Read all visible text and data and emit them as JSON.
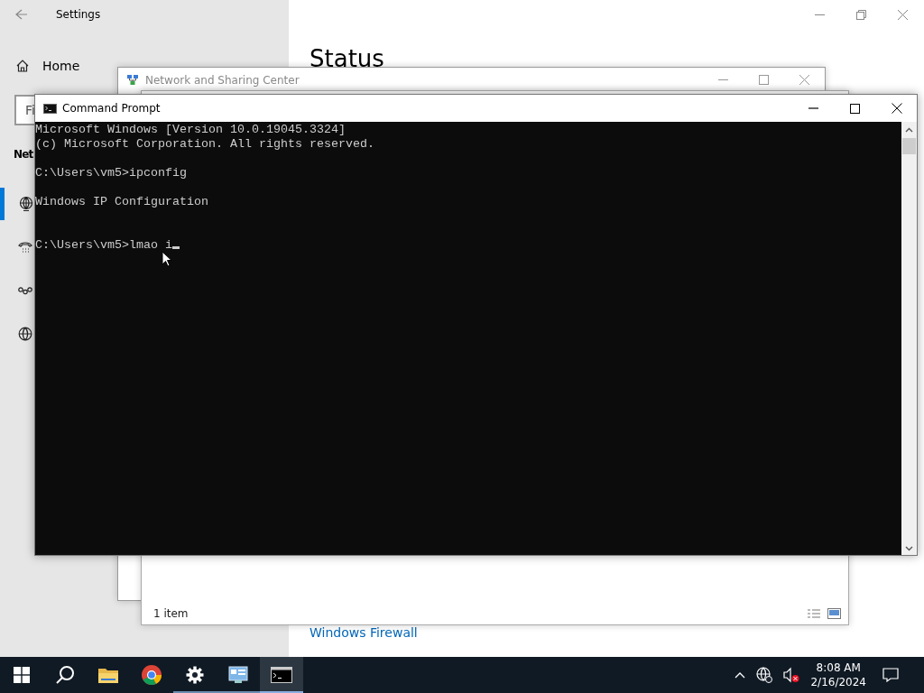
{
  "settings": {
    "title": "Settings",
    "home": "Home",
    "search": {
      "placeholder": "Fi"
    },
    "section_heading": "Net",
    "nav_items": [
      {
        "kind": "ethernet",
        "selected": true
      },
      {
        "kind": "dialup",
        "selected": false
      },
      {
        "kind": "vpn",
        "selected": false
      },
      {
        "kind": "proxy",
        "selected": false
      }
    ],
    "page_title": "Status",
    "link": "Windows Firewall"
  },
  "network_window": {
    "title": "Network and Sharing Center"
  },
  "explorer_window": {
    "status": "1 item"
  },
  "cmd": {
    "title": "Command Prompt",
    "cursor_visible": true,
    "lines": [
      {
        "kind": "text",
        "text": "Microsoft Windows [Version 10.0.19045.3324]"
      },
      {
        "kind": "text",
        "text": "(c) Microsoft Corporation. All rights reserved."
      },
      {
        "kind": "blank"
      },
      {
        "kind": "text",
        "text": "C:\\Users\\vm5>ipconfig"
      },
      {
        "kind": "blank"
      },
      {
        "kind": "text",
        "text": "Windows IP Configuration"
      },
      {
        "kind": "blank"
      },
      {
        "kind": "blank"
      },
      {
        "kind": "text",
        "text": "C:\\Users\\vm5>lmao i"
      }
    ]
  },
  "taskbar": {
    "items": [
      {
        "kind": "search",
        "running": false,
        "selected": false
      },
      {
        "kind": "folder",
        "running": false,
        "selected": false
      },
      {
        "kind": "browser",
        "running": false,
        "selected": false
      },
      {
        "kind": "gear",
        "running": true,
        "selected": false
      },
      {
        "kind": "panel",
        "running": true,
        "selected": false
      },
      {
        "kind": "terminal",
        "running": true,
        "selected": true
      }
    ],
    "time": "8:08 AM",
    "date": "2/16/2024"
  }
}
